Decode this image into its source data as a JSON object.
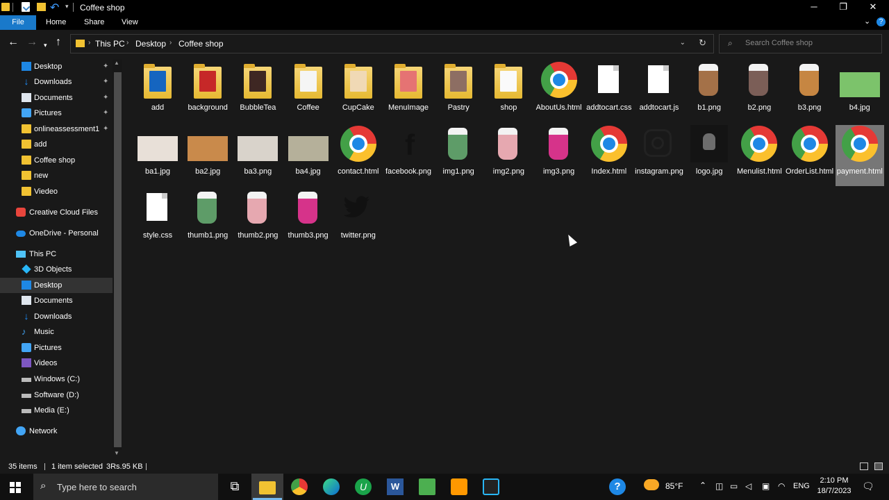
{
  "window": {
    "title": "Coffee shop",
    "minimize": "─",
    "restore": "❐",
    "close": "✕"
  },
  "ribbon": {
    "tabs": [
      "File",
      "Home",
      "Share",
      "View"
    ],
    "collapse": "⌄",
    "help": "?"
  },
  "address": {
    "crumbs": [
      "This PC",
      "Desktop",
      "Coffee shop"
    ],
    "sep": "›",
    "search_placeholder": "Search Coffee shop"
  },
  "nav": {
    "items": [
      {
        "label": "Desktop",
        "icon": "desktop-icon",
        "pinned": true
      },
      {
        "label": "Downloads",
        "icon": "download-icon",
        "pinned": true
      },
      {
        "label": "Documents",
        "icon": "documents-icon",
        "pinned": true
      },
      {
        "label": "Pictures",
        "icon": "pictures-icon",
        "pinned": true
      },
      {
        "label": "onlineassessment1",
        "icon": "folder-icon",
        "pinned": true
      },
      {
        "label": "add",
        "icon": "folder-icon"
      },
      {
        "label": "Coffee shop",
        "icon": "folder-icon"
      },
      {
        "label": "new",
        "icon": "folder-icon"
      },
      {
        "label": "Viedeo",
        "icon": "folder-icon"
      },
      {
        "label": "Creative Cloud Files",
        "icon": "creative-cloud-icon"
      },
      {
        "label": "OneDrive - Personal",
        "icon": "onedrive-icon"
      },
      {
        "label": "This PC",
        "icon": "this-pc-icon"
      },
      {
        "label": "3D Objects",
        "icon": "3d-objects-icon"
      },
      {
        "label": "Desktop",
        "icon": "desktop-icon",
        "selected": true
      },
      {
        "label": "Documents",
        "icon": "documents-icon"
      },
      {
        "label": "Downloads",
        "icon": "download-icon"
      },
      {
        "label": "Music",
        "icon": "music-icon"
      },
      {
        "label": "Pictures",
        "icon": "pictures-icon"
      },
      {
        "label": "Videos",
        "icon": "videos-icon"
      },
      {
        "label": "Windows (C:)",
        "icon": "drive-icon"
      },
      {
        "label": "Software (D:)",
        "icon": "drive-icon"
      },
      {
        "label": "Media (E:)",
        "icon": "drive-icon"
      },
      {
        "label": "Network",
        "icon": "network-icon"
      }
    ]
  },
  "files": [
    {
      "name": "add",
      "type": "folder",
      "color": "#1565c0"
    },
    {
      "name": "background",
      "type": "folder",
      "color": "#c62828"
    },
    {
      "name": "BubbleTea",
      "type": "folder",
      "color": "#3e2723"
    },
    {
      "name": "Coffee",
      "type": "folder",
      "color": "#f5f5f5"
    },
    {
      "name": "CupCake",
      "type": "folder",
      "color": "#f0d9b5"
    },
    {
      "name": "MenuImage",
      "type": "folder",
      "color": "#e57373"
    },
    {
      "name": "Pastry",
      "type": "folder",
      "color": "#8d6e63"
    },
    {
      "name": "shop",
      "type": "folder",
      "color": "#fafafa"
    },
    {
      "name": "AboutUs.html",
      "type": "chrome"
    },
    {
      "name": "addtocart.css",
      "type": "doc"
    },
    {
      "name": "addtocart.js",
      "type": "doc"
    },
    {
      "name": "b1.png",
      "type": "cup",
      "color": "#a47148"
    },
    {
      "name": "b2.png",
      "type": "cup",
      "color": "#7b5e57"
    },
    {
      "name": "b3.png",
      "type": "cup",
      "color": "#c68642"
    },
    {
      "name": "b4.jpg",
      "type": "photo",
      "color": "#7cc36b"
    },
    {
      "name": "ba1.jpg",
      "type": "photo",
      "color": "#e8e0d8"
    },
    {
      "name": "ba2.jpg",
      "type": "photo",
      "color": "#c98a4b"
    },
    {
      "name": "ba3.png",
      "type": "photo",
      "color": "#d9d3cb"
    },
    {
      "name": "ba4.jpg",
      "type": "photo",
      "color": "#b5b09a"
    },
    {
      "name": "contact.html",
      "type": "chrome"
    },
    {
      "name": "facebook.png",
      "type": "facebook"
    },
    {
      "name": "img1.png",
      "type": "cup",
      "color": "#5e9c68"
    },
    {
      "name": "img2.png",
      "type": "cup",
      "color": "#e6a8b0"
    },
    {
      "name": "img3.png",
      "type": "cup",
      "color": "#d6338a"
    },
    {
      "name": "Index.html",
      "type": "chrome"
    },
    {
      "name": "instagram.png",
      "type": "instagram"
    },
    {
      "name": "logo.jpg",
      "type": "logo"
    },
    {
      "name": "Menulist.html",
      "type": "chrome"
    },
    {
      "name": "OrderList.html",
      "type": "chrome"
    },
    {
      "name": "payment.html",
      "type": "chrome",
      "selected": true
    },
    {
      "name": "style.css",
      "type": "doc"
    },
    {
      "name": "thumb1.png",
      "type": "cup",
      "color": "#5e9c68"
    },
    {
      "name": "thumb2.png",
      "type": "cup",
      "color": "#e6a8b0"
    },
    {
      "name": "thumb3.png",
      "type": "cup",
      "color": "#d6338a"
    },
    {
      "name": "twitter.png",
      "type": "twitter"
    }
  ],
  "status": {
    "count": "35 items",
    "selected": "1 item selected",
    "size": "3Rs.95 KB"
  },
  "taskbar": {
    "search_placeholder": "Type here to search",
    "weather": "85°F",
    "lang": "ENG",
    "time": "2:10 PM",
    "date": "18/7/2023"
  }
}
